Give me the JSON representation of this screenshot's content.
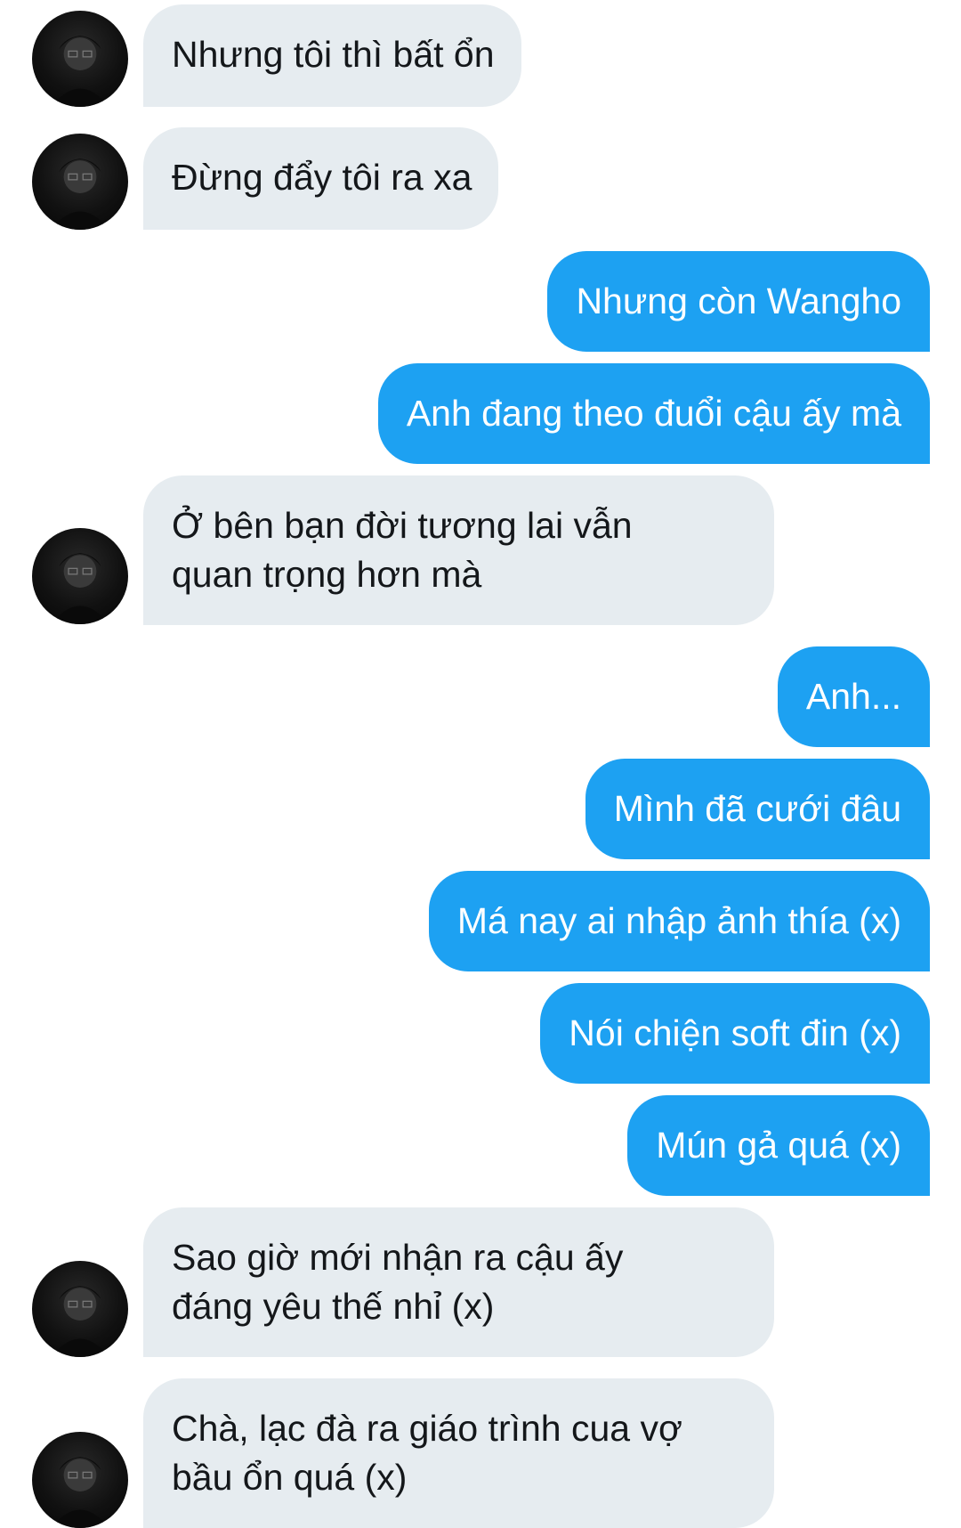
{
  "conversation": {
    "colors": {
      "incoming_bubble": "#e6ecf0",
      "outgoing_bubble": "#1da1f2",
      "incoming_text": "#14171a",
      "outgoing_text": "#ffffff"
    },
    "messages": [
      {
        "side": "in",
        "text": "Nhưng tôi thì bất ổn"
      },
      {
        "side": "in",
        "text": "Đừng đẩy tôi ra xa"
      },
      {
        "side": "out",
        "text": "Nhưng còn Wangho"
      },
      {
        "side": "out",
        "text": "Anh đang theo đuổi cậu ấy mà"
      },
      {
        "side": "in",
        "text": "Ở bên bạn đời tương lai vẫn\nquan trọng hơn mà"
      },
      {
        "side": "out",
        "text": "Anh..."
      },
      {
        "side": "out",
        "text": "Mình đã cưới đâu"
      },
      {
        "side": "out",
        "text": "Má nay ai nhập ảnh thía (x)"
      },
      {
        "side": "out",
        "text": "Nói chiện soft đin (x)"
      },
      {
        "side": "out",
        "text": "Mún gả quá (x)"
      },
      {
        "side": "in",
        "text": "Sao giờ mới nhận ra cậu ấy\nđáng yêu thế nhỉ (x)"
      },
      {
        "side": "in",
        "text": "Chà, lạc đà ra giáo trình cua vợ\nbầu ổn quá (x)"
      }
    ]
  }
}
